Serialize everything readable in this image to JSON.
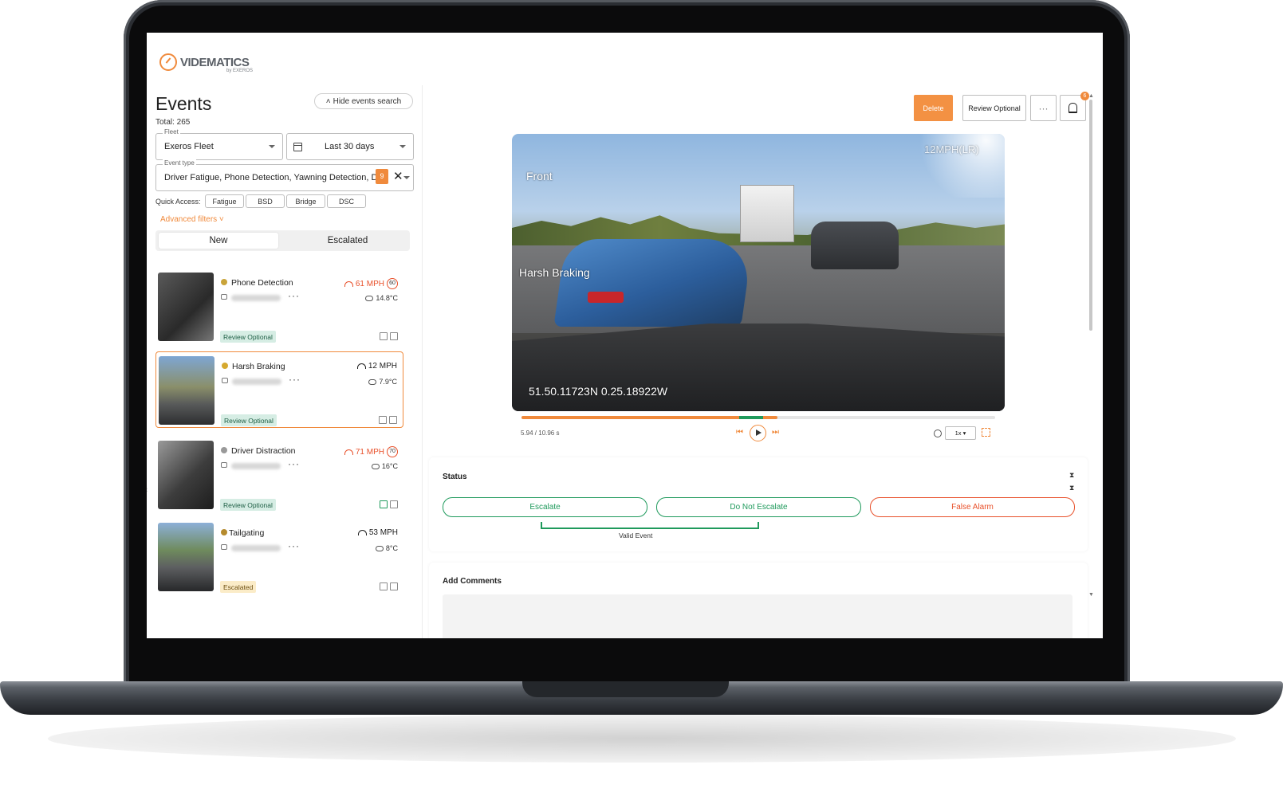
{
  "brand": {
    "name": "VIDEMATICS",
    "sub": "by EXEROS",
    "accent": "#f08a3c"
  },
  "sidebar": {
    "title": "Events",
    "total": "Total: 265",
    "hide_search": "Hide events search",
    "fleet": {
      "label": "Fleet",
      "value": "Exeros Fleet"
    },
    "date_range": {
      "value": "Last 30 days"
    },
    "event_type": {
      "label": "Event type",
      "value": "Driver Fatigue, Phone Detection, Yawning Detection, Dri...",
      "count": "9"
    },
    "quick_access": {
      "label": "Quick Access:",
      "chips": [
        "Fatigue",
        "BSD",
        "Bridge",
        "DSC"
      ]
    },
    "advanced_filters": "Advanced filters ˅",
    "tabs": [
      "New",
      "Escalated"
    ],
    "events": [
      {
        "title": "Phone Detection",
        "speed": "61 MPH",
        "limit": "60",
        "speed_alert": true,
        "temp": "14.8°C",
        "tag": "Review Optional"
      },
      {
        "title": "Harsh Braking",
        "speed": "12 MPH",
        "limit": "",
        "speed_alert": false,
        "temp": "7.9°C",
        "tag": "Review Optional"
      },
      {
        "title": "Driver Distraction",
        "speed": "71 MPH",
        "limit": "70",
        "speed_alert": true,
        "temp": "16°C",
        "tag": "Review Optional"
      },
      {
        "title": "Tailgating",
        "speed": "53 MPH",
        "limit": "",
        "speed_alert": false,
        "temp": "8°C",
        "tag": "Escalated"
      }
    ]
  },
  "toolbar": {
    "delete": "Delete",
    "review_optional": "Review Optional",
    "more": "···",
    "notif_count": "6"
  },
  "video": {
    "camera": "Front",
    "event_label": "Harsh Braking",
    "speed_overlay": "12MPH(LR)",
    "coords": "51.50.11723N 0.25.18922W",
    "time": "5.94 / 10.96 s",
    "progress": 0.54,
    "playback_speed": "1x ▾"
  },
  "status": {
    "label": "Status",
    "escalate": "Escalate",
    "do_not_escalate": "Do Not Escalate",
    "false_alarm": "False Alarm",
    "valid_event": "Valid Event"
  },
  "comments": {
    "label": "Add Comments"
  },
  "colors": {
    "green": "#1f9a5c",
    "red": "#e8502a",
    "orange": "#f08a3c"
  }
}
